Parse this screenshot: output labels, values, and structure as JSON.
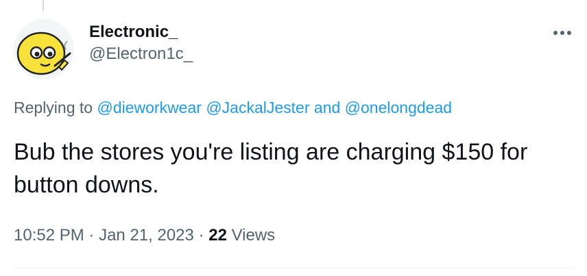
{
  "author": {
    "display_name": "Electronic_",
    "handle": "@Electron1c_",
    "avatar_icon": "yellow-cartoon-face-smoking-avatar"
  },
  "reply_context": {
    "prefix": "Replying to",
    "mention_1": "@dieworkwear",
    "mention_2": "@JackalJester",
    "conjunction": "and",
    "mention_3": "@onelongdead"
  },
  "tweet": {
    "text": "Bub the stores you're listing are charging $150 for button downs."
  },
  "meta": {
    "time": "10:52 PM",
    "separator": "·",
    "date": "Jan 21, 2023",
    "views_count": "22",
    "views_label": "Views"
  },
  "icons": {
    "more": "more-horizontal-icon"
  },
  "colors": {
    "link": "#1d9bf0",
    "secondary_text": "#536471",
    "primary_text": "#0f1419",
    "avatar_yellow": "#f6e23b"
  }
}
